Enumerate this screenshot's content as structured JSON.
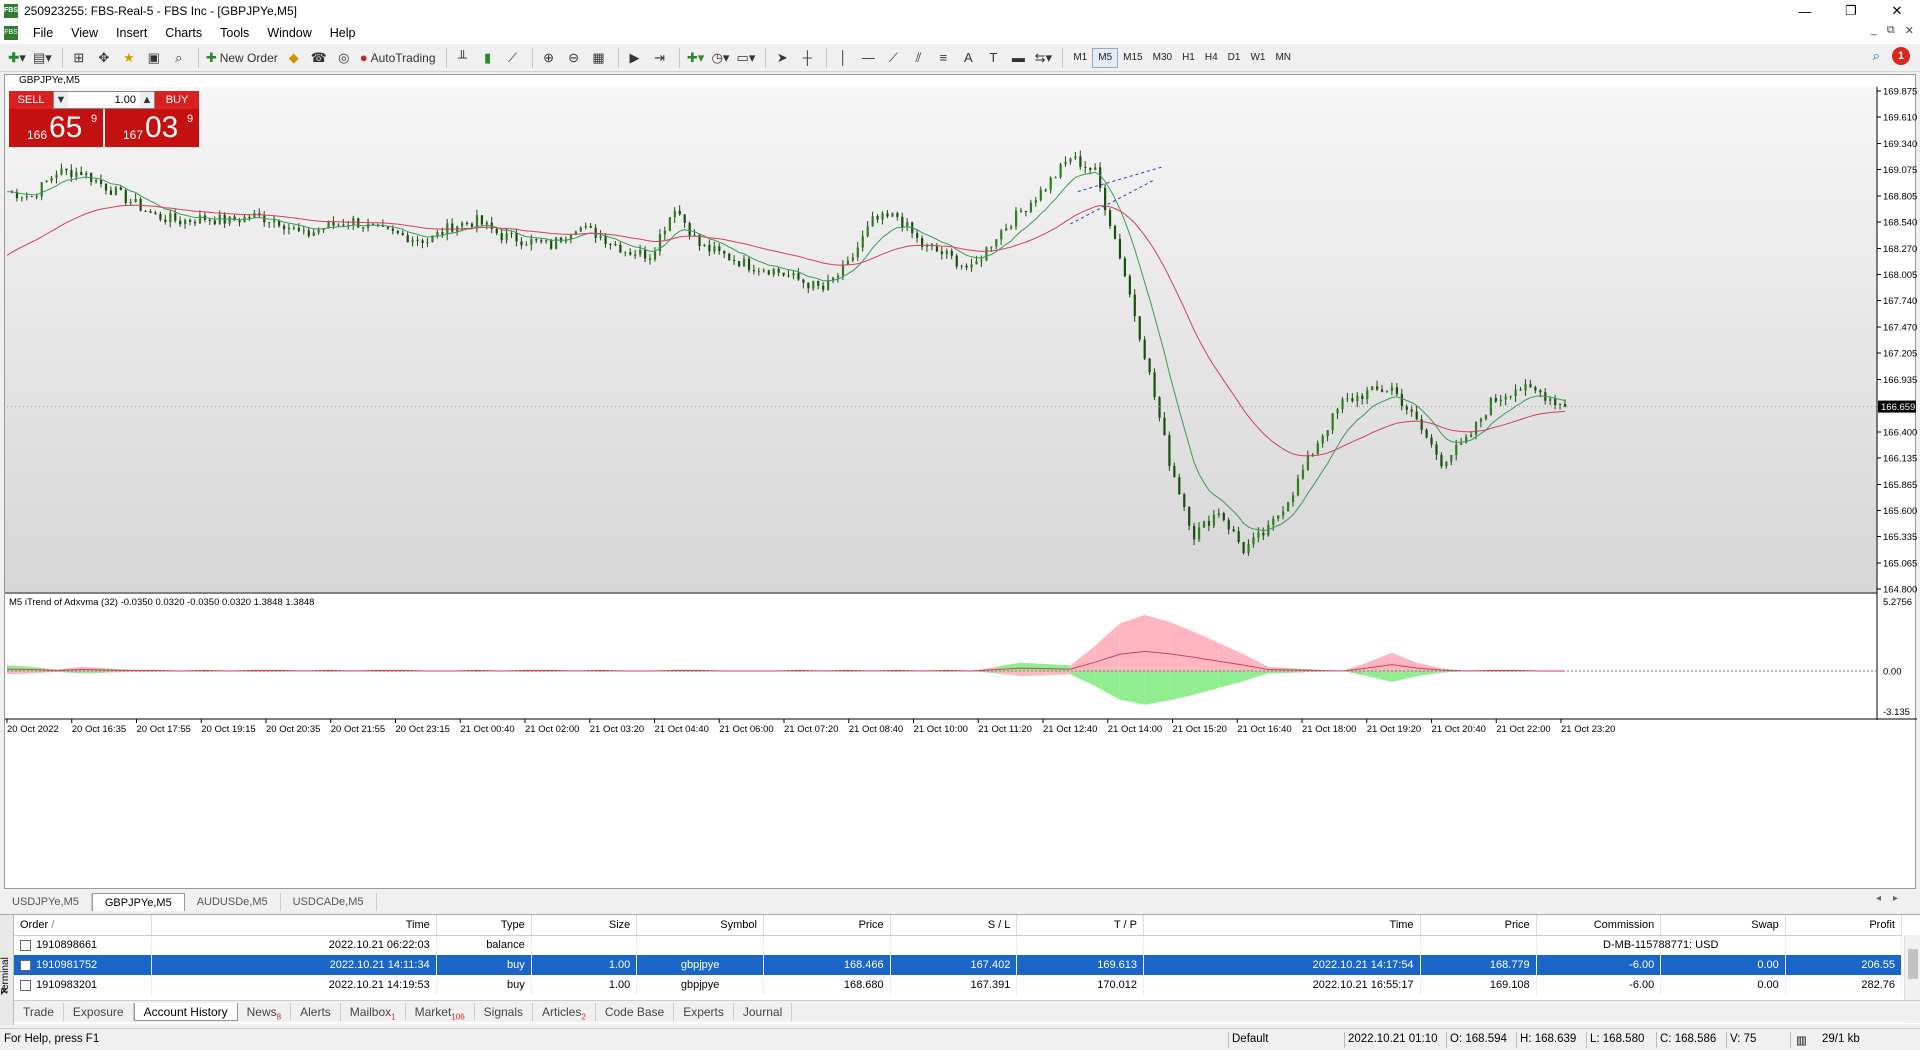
{
  "window": {
    "title": "250923255: FBS-Real-5 - FBS Inc - [GBPJPYe,M5]",
    "app_icon": "FBS",
    "controls": [
      "—",
      "❐",
      "✕"
    ]
  },
  "menu": {
    "items": [
      "File",
      "View",
      "Insert",
      "Charts",
      "Tools",
      "Window",
      "Help"
    ]
  },
  "toolbar": {
    "new_order_label": "New Order",
    "autotrading_label": "AutoTrading",
    "timeframes": [
      "M1",
      "M5",
      "M15",
      "M30",
      "H1",
      "H4",
      "D1",
      "W1",
      "MN"
    ],
    "active_timeframe": "M5",
    "notification_count": "1"
  },
  "chart": {
    "header_label": "GBPJPYe,M5",
    "one_click": {
      "sell_label": "SELL",
      "buy_label": "BUY",
      "lot": "1.00",
      "sell_small": "166",
      "sell_big": "65",
      "sell_sup": "9",
      "buy_small": "167",
      "buy_big": "03",
      "buy_sup": "9"
    },
    "indicator_label": "M5 iTrend of Adxvma (32) -0.0350 0.0320 -0.0350 0.0320 1.3848 1.3848",
    "current_price": "166.659",
    "colors": {
      "bull_candle": "#2e7d1e",
      "bear_candle": "#1a4d10",
      "ma_fast": "#3a9a56",
      "ma_slow": "#d04060",
      "osc_pink": "#ffb6c1",
      "osc_green": "#90ee90",
      "trendline": "#1a3fd6"
    }
  },
  "chart_data": {
    "type": "line",
    "title": "GBPJPYe,M5",
    "ylim": [
      164.8,
      169.875
    ],
    "y_ticks": [
      "169.875",
      "169.610",
      "169.340",
      "169.075",
      "168.805",
      "168.540",
      "168.270",
      "168.005",
      "167.740",
      "167.470",
      "167.205",
      "166.935",
      "166.659",
      "166.400",
      "166.135",
      "165.865",
      "165.600",
      "165.335",
      "165.065",
      "164.800"
    ],
    "x_ticks": [
      "20 Oct 2022",
      "20 Oct 16:35",
      "20 Oct 17:55",
      "20 Oct 19:15",
      "20 Oct 20:35",
      "20 Oct 21:55",
      "20 Oct 23:15",
      "21 Oct 00:40",
      "21 Oct 02:00",
      "21 Oct 03:20",
      "21 Oct 04:40",
      "21 Oct 06:00",
      "21 Oct 07:20",
      "21 Oct 08:40",
      "21 Oct 10:00",
      "21 Oct 11:20",
      "21 Oct 12:40",
      "21 Oct 14:00",
      "21 Oct 15:20",
      "21 Oct 16:40",
      "21 Oct 18:00",
      "21 Oct 19:20",
      "21 Oct 20:40",
      "21 Oct 22:00",
      "21 Oct 23:20"
    ],
    "series": [
      {
        "name": "Close",
        "values": [
          168.85,
          168.8,
          169.05,
          169.05,
          168.9,
          168.75,
          168.6,
          168.55,
          168.58,
          168.55,
          168.6,
          168.55,
          168.4,
          168.5,
          168.55,
          168.45,
          168.4,
          168.35,
          168.5,
          168.55,
          168.4,
          168.35,
          168.3,
          168.5,
          168.4,
          168.25,
          168.2,
          168.7,
          168.3,
          168.2,
          168.1,
          168.05,
          167.95,
          167.85,
          168.1,
          168.55,
          168.6,
          168.3,
          168.2,
          168.05,
          168.4,
          168.65,
          168.9,
          169.2,
          169.05,
          168.2,
          167.2,
          166.1,
          165.35,
          165.6,
          165.2,
          165.4,
          165.8,
          166.3,
          166.7,
          166.8,
          166.85,
          166.5,
          166.1,
          166.3,
          166.7,
          166.85,
          166.8,
          166.66
        ]
      },
      {
        "name": "Oscillator",
        "values": [
          -0.4,
          -0.3,
          0.1,
          0.3,
          -0.2,
          -0.1,
          0.1,
          0.0,
          0.1,
          0.0,
          -0.1,
          0.1,
          0.0,
          0.1,
          0.0,
          -0.1,
          0.1,
          0.0,
          0.0,
          0.1,
          0.0,
          -0.1,
          0.1,
          0.0,
          0.1,
          0.0,
          0.0,
          0.1,
          -0.1,
          0.0,
          0.0,
          0.0,
          -0.1,
          0.0,
          0.1,
          0.0,
          0.1,
          0.0,
          -0.1,
          0.0,
          -0.3,
          -0.6,
          -0.5,
          0.4,
          1.8,
          3.4,
          4.0,
          3.5,
          2.8,
          2.0,
          1.2,
          0.3,
          -0.2,
          0.1,
          0.0,
          0.6,
          1.3,
          0.6,
          0.2,
          0.0,
          -0.1,
          0.1,
          0.0,
          0.0
        ]
      }
    ],
    "osc_ticks": [
      "5.2756",
      "0.00",
      "-3.135"
    ],
    "osc_ylim": [
      -3.135,
      5.2756
    ]
  },
  "chart_tabs": {
    "items": [
      "USDJPYe,M5",
      "GBPJPYe,M5",
      "AUDUSDe,M5",
      "USDCADe,M5"
    ],
    "active": "GBPJPYe,M5"
  },
  "terminal": {
    "side_label": "Terminal",
    "columns": [
      "Order",
      "/",
      "Time",
      "Type",
      "Size",
      "Symbol",
      "Price",
      "S / L",
      "T / P",
      "Time",
      "Price",
      "Commission",
      "Swap",
      "Profit"
    ],
    "rows": [
      {
        "order": "1910898661",
        "time": "2022.10.21 06:22:03",
        "type": "balance",
        "size": "",
        "symbol": "",
        "price": "",
        "sl": "",
        "tp": "",
        "time2": "",
        "price2": "",
        "commission": "D-MB-115788771: USD",
        "swap": "",
        "profit": ""
      },
      {
        "order": "1910981752",
        "time": "2022.10.21 14:11:34",
        "type": "buy",
        "size": "1.00",
        "symbol": "gbpjpye",
        "price": "168.466",
        "sl": "167.402",
        "tp": "169.613",
        "time2": "2022.10.21 14:17:54",
        "price2": "168.779",
        "commission": "-6.00",
        "swap": "0.00",
        "profit": "206.55"
      },
      {
        "order": "1910983201",
        "time": "2022.10.21 14:19:53",
        "type": "buy",
        "size": "1.00",
        "symbol": "gbpjpye",
        "price": "168.680",
        "sl": "167.391",
        "tp": "170.012",
        "time2": "2022.10.21 16:55:17",
        "price2": "169.108",
        "commission": "-6.00",
        "swap": "0.00",
        "profit": "282.76"
      }
    ],
    "tabs": [
      {
        "label": "Trade",
        "badge": ""
      },
      {
        "label": "Exposure",
        "badge": ""
      },
      {
        "label": "Account History",
        "badge": ""
      },
      {
        "label": "News",
        "badge": "8"
      },
      {
        "label": "Alerts",
        "badge": ""
      },
      {
        "label": "Mailbox",
        "badge": "1"
      },
      {
        "label": "Market",
        "badge": "106"
      },
      {
        "label": "Signals",
        "badge": ""
      },
      {
        "label": "Articles",
        "badge": "2"
      },
      {
        "label": "Code Base",
        "badge": ""
      },
      {
        "label": "Experts",
        "badge": ""
      },
      {
        "label": "Journal",
        "badge": ""
      }
    ],
    "active_tab": "Account History"
  },
  "status": {
    "help": "For Help, press F1",
    "profile": "Default",
    "datetime": "2022.10.21 01:10",
    "open": "O: 168.594",
    "high": "H: 168.639",
    "low": "L: 168.580",
    "close": "C: 168.586",
    "volume": "V: 75",
    "traffic": "29/1 kb"
  }
}
